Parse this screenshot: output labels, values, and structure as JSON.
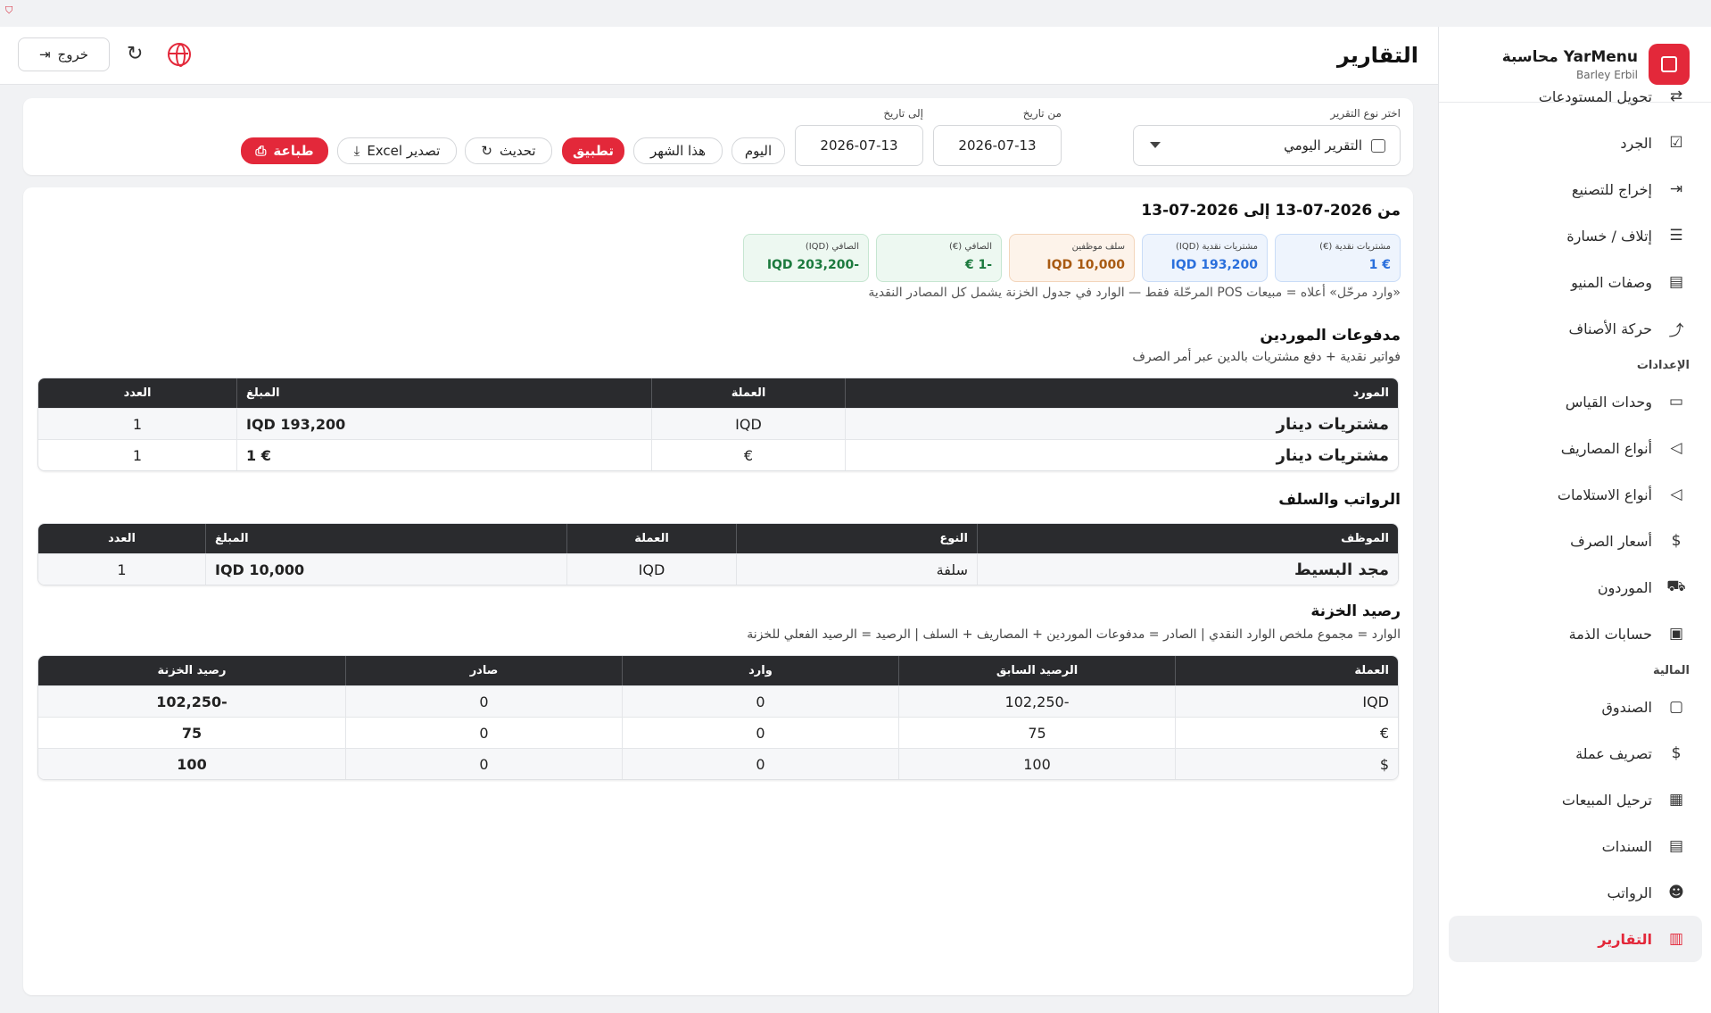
{
  "brand": {
    "title": "YarMenu محاسبة",
    "subtitle": "Barley Erbil"
  },
  "sidebar": {
    "items_top": [
      {
        "label": "تحويل المستودعات",
        "icon": "transfer-icon"
      },
      {
        "label": "الجرد",
        "icon": "checklist-icon"
      },
      {
        "label": "إخراج للتصنيع",
        "icon": "exit-icon"
      },
      {
        "label": "إتلاف / خسارة",
        "icon": "waste-icon"
      },
      {
        "label": "وصفات المنيو",
        "icon": "recipe-icon"
      },
      {
        "label": "حركة الأصناف",
        "icon": "trend-icon"
      }
    ],
    "section_settings": "الإعدادات",
    "items_settings": [
      {
        "label": "وحدات القياس",
        "icon": "ruler-icon"
      },
      {
        "label": "أنواع المصاريف",
        "icon": "tag-icon"
      },
      {
        "label": "أنواع الاستلامات",
        "icon": "tag-icon"
      },
      {
        "label": "أسعار الصرف",
        "icon": "exchange-icon"
      },
      {
        "label": "الموردون",
        "icon": "truck-icon"
      },
      {
        "label": "حسابات الذمة",
        "icon": "id-card-icon"
      }
    ],
    "section_finance": "المالية",
    "items_finance": [
      {
        "label": "الصندوق",
        "icon": "wallet-icon"
      },
      {
        "label": "تصريف عملة",
        "icon": "exchange-icon"
      },
      {
        "label": "ترحيل المبيعات",
        "icon": "register-icon"
      },
      {
        "label": "السندات",
        "icon": "receipt-icon"
      },
      {
        "label": "الرواتب",
        "icon": "people-icon"
      },
      {
        "label": "التقارير",
        "icon": "report-icon"
      }
    ]
  },
  "header": {
    "title": "التقارير",
    "logout_label": "خروج"
  },
  "filters": {
    "report_type_label": "اختر نوع التقرير",
    "report_type_value": "التقرير اليومي",
    "from_label": "من تاريخ",
    "from_value": "2026-07-13",
    "to_label": "إلى تاريخ",
    "to_value": "2026-07-13",
    "today": "اليوم",
    "this_month": "هذا الشهر",
    "apply": "تطبيق",
    "update": "تحديث",
    "excel": "تصدير Excel",
    "print": "طباعة"
  },
  "report": {
    "range": "من 2026-07-13 إلى 2026-07-13",
    "kpis": [
      {
        "label": "مشتريات نقدية (€)",
        "value": "€ 1",
        "tone": "blue"
      },
      {
        "label": "مشتريات نقدية (IQD)",
        "value": "IQD 193,200",
        "tone": "blue"
      },
      {
        "label": "سلف موظفين",
        "value": "IQD 10,000",
        "tone": "orange"
      },
      {
        "label": "الصافي (€)",
        "value": "-1 €",
        "tone": "green"
      },
      {
        "label": "الصافي (IQD)",
        "value": "-IQD 203,200",
        "tone": "green"
      }
    ],
    "kpi_note": "«وارد مرحّل» أعلاه = مبيعات POS المرحّلة فقط — الوارد في جدول الخزنة يشمل كل المصادر النقدية",
    "suppliers": {
      "title": "مدفوعات الموردين",
      "subtitle": "فواتير نقدية + دفع مشتريات بالدين عبر أمر الصرف",
      "headers": [
        "المورد",
        "العملة",
        "المبلغ",
        "العدد"
      ],
      "rows": [
        [
          "مشتريات دينار",
          "IQD",
          "IQD 193,200",
          "1"
        ],
        [
          "مشتريات دينار",
          "€",
          "€ 1",
          "1"
        ]
      ]
    },
    "salaries": {
      "title": "الرواتب والسلف",
      "headers": [
        "الموظف",
        "النوع",
        "العملة",
        "المبلغ",
        "العدد"
      ],
      "rows": [
        [
          "مجد البسيط",
          "سلفة",
          "IQD",
          "IQD 10,000",
          "1"
        ]
      ]
    },
    "treasury": {
      "title": "رصيد الخزنة",
      "subtitle": "الوارد = مجموع ملخص الوارد النقدي | الصادر = مدفوعات الموردين + المصاريف + السلف | الرصيد = الرصيد الفعلي للخزنة",
      "headers": [
        "العملة",
        "الرصيد السابق",
        "وارد",
        "صادر",
        "رصيد الخزنة"
      ],
      "rows": [
        [
          "IQD",
          "-102,250",
          "0",
          "0",
          "-102,250"
        ],
        [
          "€",
          "75",
          "0",
          "0",
          "75"
        ],
        [
          "$",
          "100",
          "0",
          "0",
          "100"
        ]
      ]
    }
  },
  "colors": {
    "accent": "#e3283a",
    "blue": "#2a6fdc",
    "brown": "#8a4a10",
    "header_dark": "#2a2b2e"
  }
}
